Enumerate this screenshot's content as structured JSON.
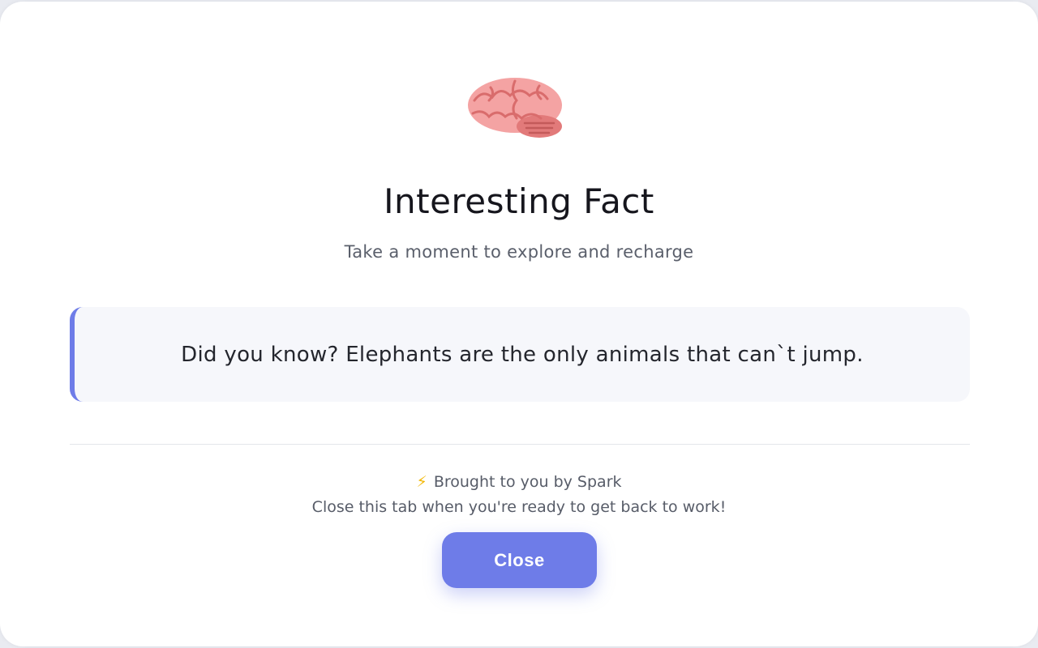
{
  "header": {
    "icon": "brain-icon",
    "title": "Interesting Fact",
    "subtitle": "Take a moment to explore and recharge"
  },
  "fact": {
    "text": "Did you know? Elephants are the only animals that can`t jump."
  },
  "footer": {
    "credit_icon": "lightning-icon",
    "credit_text": "Brought to you by Spark",
    "hint": "Close this tab when you're ready to get back to work!",
    "close_label": "Close"
  },
  "colors": {
    "accent": "#6e7ce8",
    "fact_background": "#f6f7fb",
    "brain_pink": "#f4a3a3"
  }
}
